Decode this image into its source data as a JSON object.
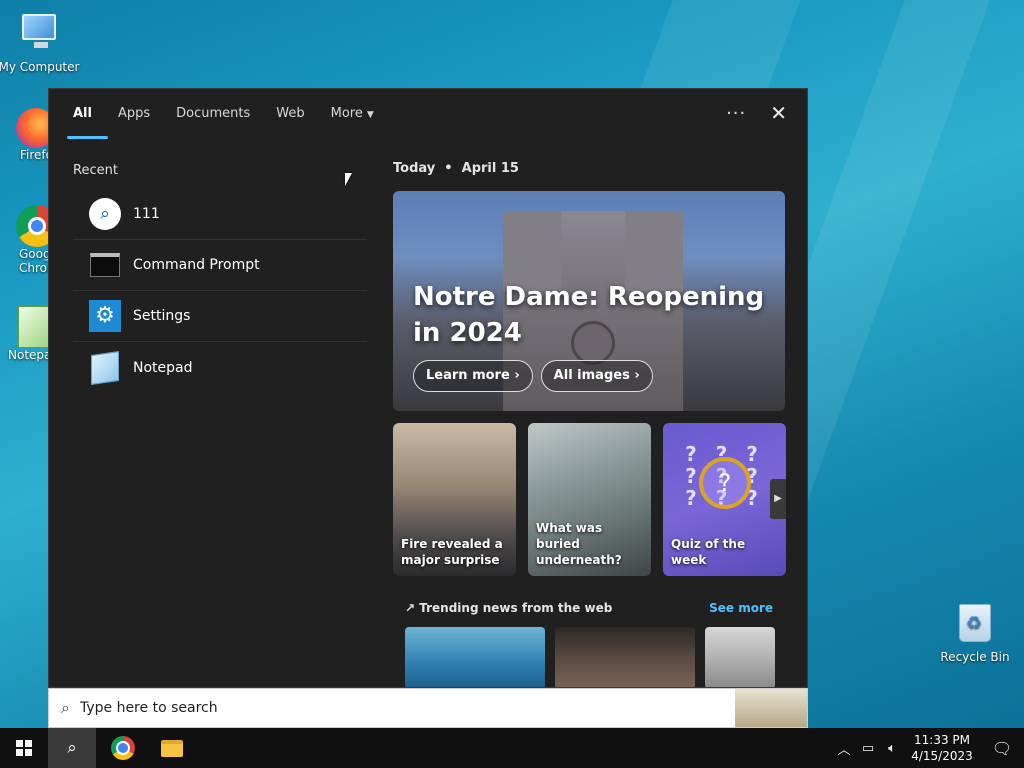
{
  "desktop": {
    "icons": [
      {
        "label": "My Computer"
      },
      {
        "label": "Firefo"
      },
      {
        "label": "Goog\nChrom"
      },
      {
        "label": "Notepa"
      },
      {
        "label": "Recycle Bin"
      }
    ]
  },
  "search_panel": {
    "tabs": [
      {
        "label": "All",
        "active": true
      },
      {
        "label": "Apps"
      },
      {
        "label": "Documents"
      },
      {
        "label": "Web"
      },
      {
        "label": "More"
      }
    ],
    "more_actions_icon": "ellipsis-icon",
    "close_icon": "close-icon",
    "recent_title": "Recent",
    "recent_items": [
      {
        "label": "111",
        "icon": "search-icon"
      },
      {
        "label": "Command Prompt",
        "icon": "command-prompt-icon"
      },
      {
        "label": "Settings",
        "icon": "gear-icon"
      },
      {
        "label": "Notepad",
        "icon": "notepad-icon"
      }
    ],
    "date_line": "Today  •  April 15",
    "hero": {
      "title": "Notre Dame: Reopening in 2024",
      "learn_more": "Learn more",
      "all_images": "All images"
    },
    "cards": [
      {
        "caption": "Fire revealed a major surprise"
      },
      {
        "caption": "What was buried underneath?"
      },
      {
        "caption": "Quiz of the week"
      }
    ],
    "trending_title": "Trending news from the web",
    "see_more": "See more"
  },
  "searchbar": {
    "placeholder": "Type here to search"
  },
  "taskbar": {
    "time": "11:33 PM",
    "date": "4/15/2023"
  },
  "colors": {
    "accent": "#4cc2ff",
    "panel_bg": "#202020",
    "taskbar_bg": "#101010"
  }
}
